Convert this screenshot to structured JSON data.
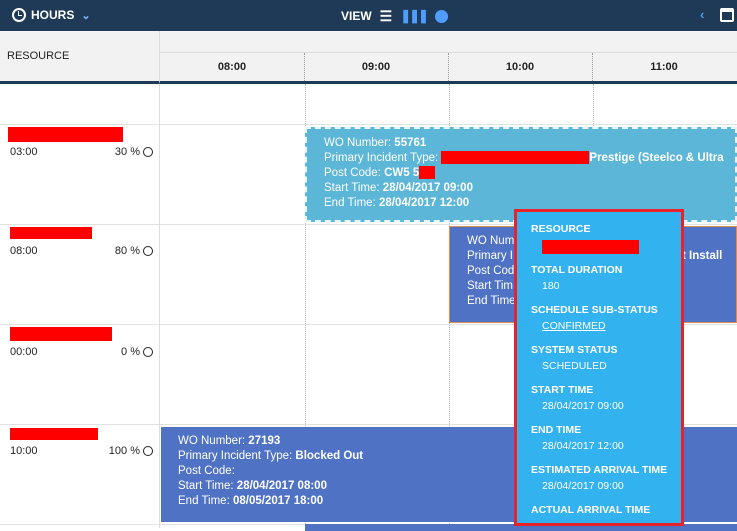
{
  "toolbar": {
    "hours_label": "HOURS",
    "view_label": "VIEW"
  },
  "header": {
    "resource_label": "RESOURCE",
    "hours": [
      "08:00",
      "09:00",
      "10:00",
      "11:00"
    ]
  },
  "resources": [
    {
      "time": "03:00",
      "percent": "30 %"
    },
    {
      "time": "08:00",
      "percent": "80 %"
    },
    {
      "time": "00:00",
      "percent": "0 %"
    },
    {
      "time": "10:00",
      "percent": "100 %"
    }
  ],
  "bookings": [
    {
      "wo_label": "WO Number: ",
      "wo_value": "55761",
      "incident_label": "Primary Incident Type: ",
      "incident_value": "Prestige (Steelco & Ultra",
      "postcode_label": "Post Code: ",
      "postcode_value": "CW5 5",
      "start_label": "Start Time: ",
      "start_value": "28/04/2017 09:00",
      "end_label": "End Time: ",
      "end_value": "28/04/2017 12:00"
    },
    {
      "wo_label": "WO Number",
      "incident_label": "Primary I",
      "incident_tail": "nt Install",
      "postcode_label": "Post Cod",
      "start_label": "Start Tim",
      "end_label": "End Time"
    },
    {
      "wo_label": "WO Number: ",
      "wo_value": "27193",
      "incident_label": "Primary Incident Type: ",
      "incident_value": "Blocked Out",
      "postcode_label": "Post Code:",
      "start_label": "Start Time: ",
      "start_value": "28/04/2017 08:00",
      "end_label": "End Time: ",
      "end_value": "08/05/2017 18:00"
    }
  ],
  "tooltip": {
    "resource_label": "RESOURCE",
    "total_duration_label": "TOTAL DURATION",
    "total_duration_value": "180",
    "sub_status_label": "SCHEDULE SUB-STATUS",
    "sub_status_value": "CONFIRMED",
    "system_status_label": "SYSTEM STATUS",
    "system_status_value": "SCHEDULED",
    "start_time_label": "START TIME",
    "start_time_value": "28/04/2017 09:00",
    "end_time_label": "END TIME",
    "end_time_value": "28/04/2017 12:00",
    "eta_label": "ESTIMATED ARRIVAL TIME",
    "eta_value": "28/04/2017 09:00",
    "actual_arrival_label": "ACTUAL ARRIVAL TIME"
  },
  "colors": {
    "topbar": "#1f3a56",
    "accent": "#4f9dff",
    "booking_selected": "#5bb6d8",
    "booking": "#4f72c4",
    "tooltip": "#33b2f0",
    "tooltip_border": "#e8222b",
    "redaction": "#ff0000"
  }
}
